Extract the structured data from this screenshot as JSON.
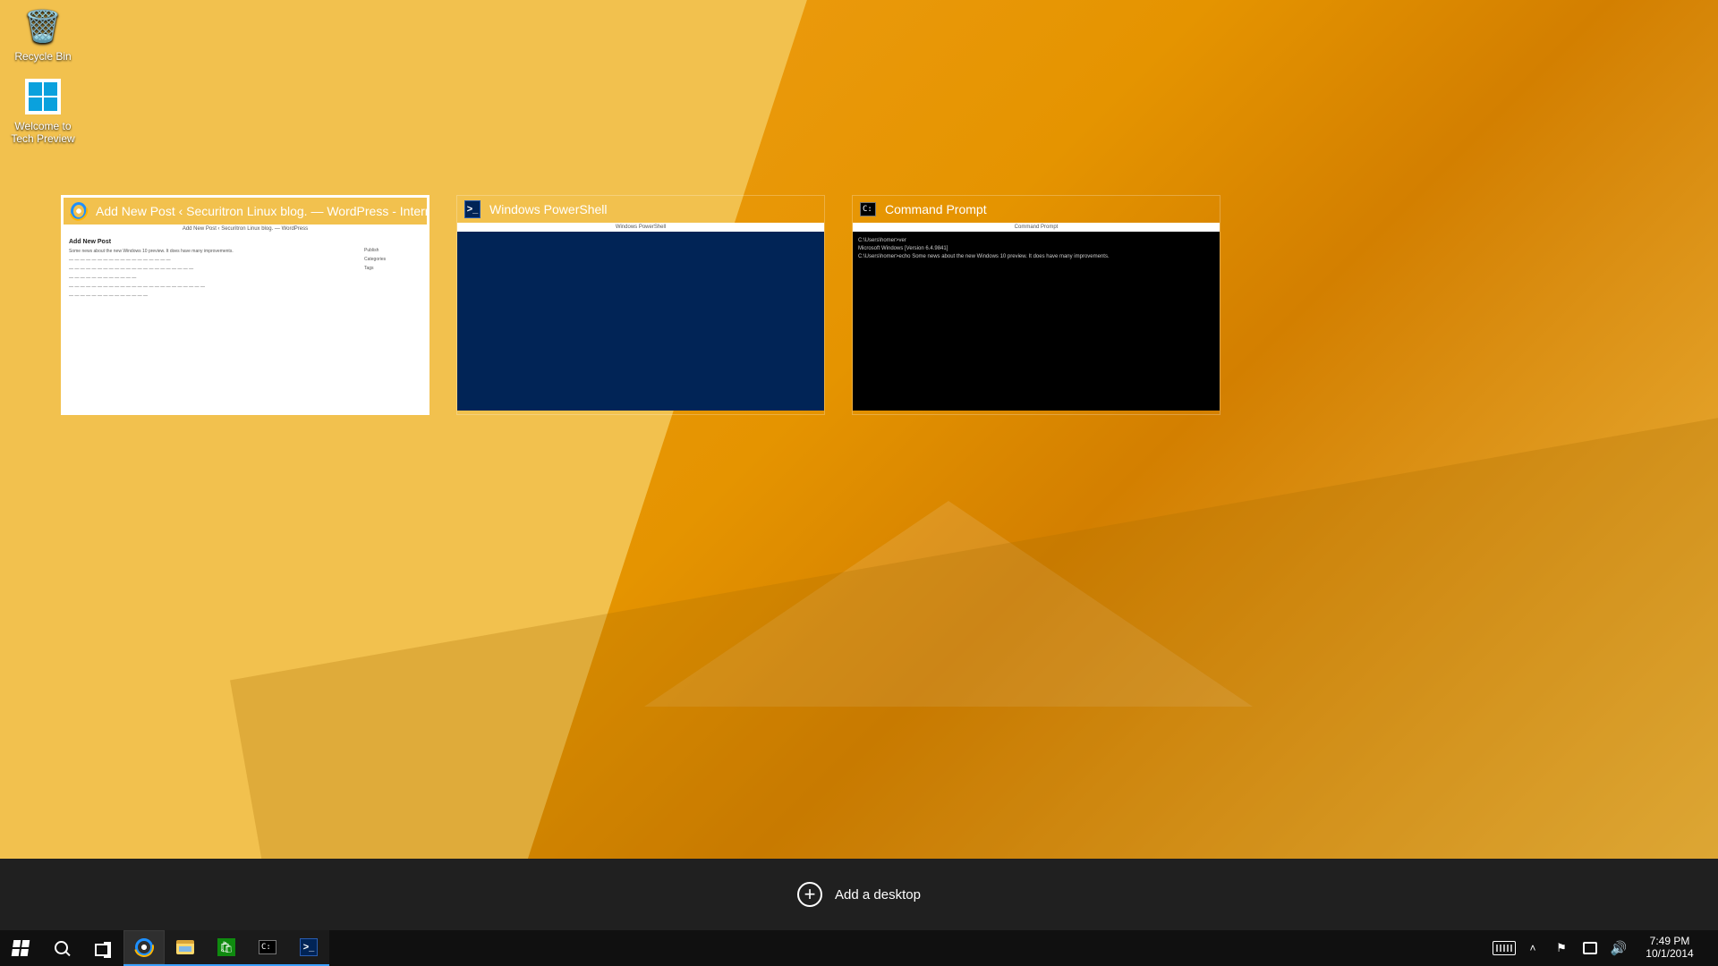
{
  "desktop": {
    "icons": [
      {
        "name": "recycle-bin",
        "label": "Recycle Bin"
      },
      {
        "name": "welcome-tech-preview",
        "label": "Welcome to Tech Preview"
      }
    ]
  },
  "taskview": {
    "windows": [
      {
        "app": "internet-explorer",
        "title": "Add New Post ‹ Securitron Linux blog. — WordPress - Internet E...",
        "active": true,
        "thumb": {
          "titlebar": "Add New Post ‹ Securitron Linux blog. — WordPress",
          "heading": "Add New Post",
          "subheading": "Some news about the new Windows 10 preview. It does have many improvements.",
          "sidebar": [
            "Publish",
            "Categories",
            "Tags"
          ]
        }
      },
      {
        "app": "powershell",
        "title": "Windows PowerShell",
        "active": false,
        "thumb": {
          "titlebar": "Windows PowerShell"
        }
      },
      {
        "app": "cmd",
        "title": "Command Prompt",
        "active": false,
        "thumb": {
          "titlebar": "Command Prompt",
          "lines": [
            "C:\\Users\\homer>ver",
            "Microsoft Windows [Version 6.4.9841]",
            "C:\\Users\\homer>echo Some news about the new Windows 10 preview. It does have many improvements."
          ]
        }
      }
    ],
    "add_desktop_label": "Add a desktop"
  },
  "taskbar": {
    "buttons": [
      {
        "name": "start",
        "icon": "windows"
      },
      {
        "name": "search",
        "icon": "search"
      },
      {
        "name": "task-view",
        "icon": "taskview"
      },
      {
        "name": "internet-explorer",
        "icon": "ie",
        "state": "active"
      },
      {
        "name": "file-explorer",
        "icon": "explorer",
        "state": "running"
      },
      {
        "name": "store",
        "icon": "store",
        "state": "running"
      },
      {
        "name": "command-prompt",
        "icon": "cmd",
        "state": "running"
      },
      {
        "name": "powershell",
        "icon": "ps",
        "state": "running"
      }
    ],
    "tray": {
      "items": [
        "keyboard",
        "chevron-up",
        "action-center-flag",
        "network",
        "volume"
      ]
    },
    "clock": {
      "time": "7:49 PM",
      "date": "10/1/2014"
    }
  }
}
